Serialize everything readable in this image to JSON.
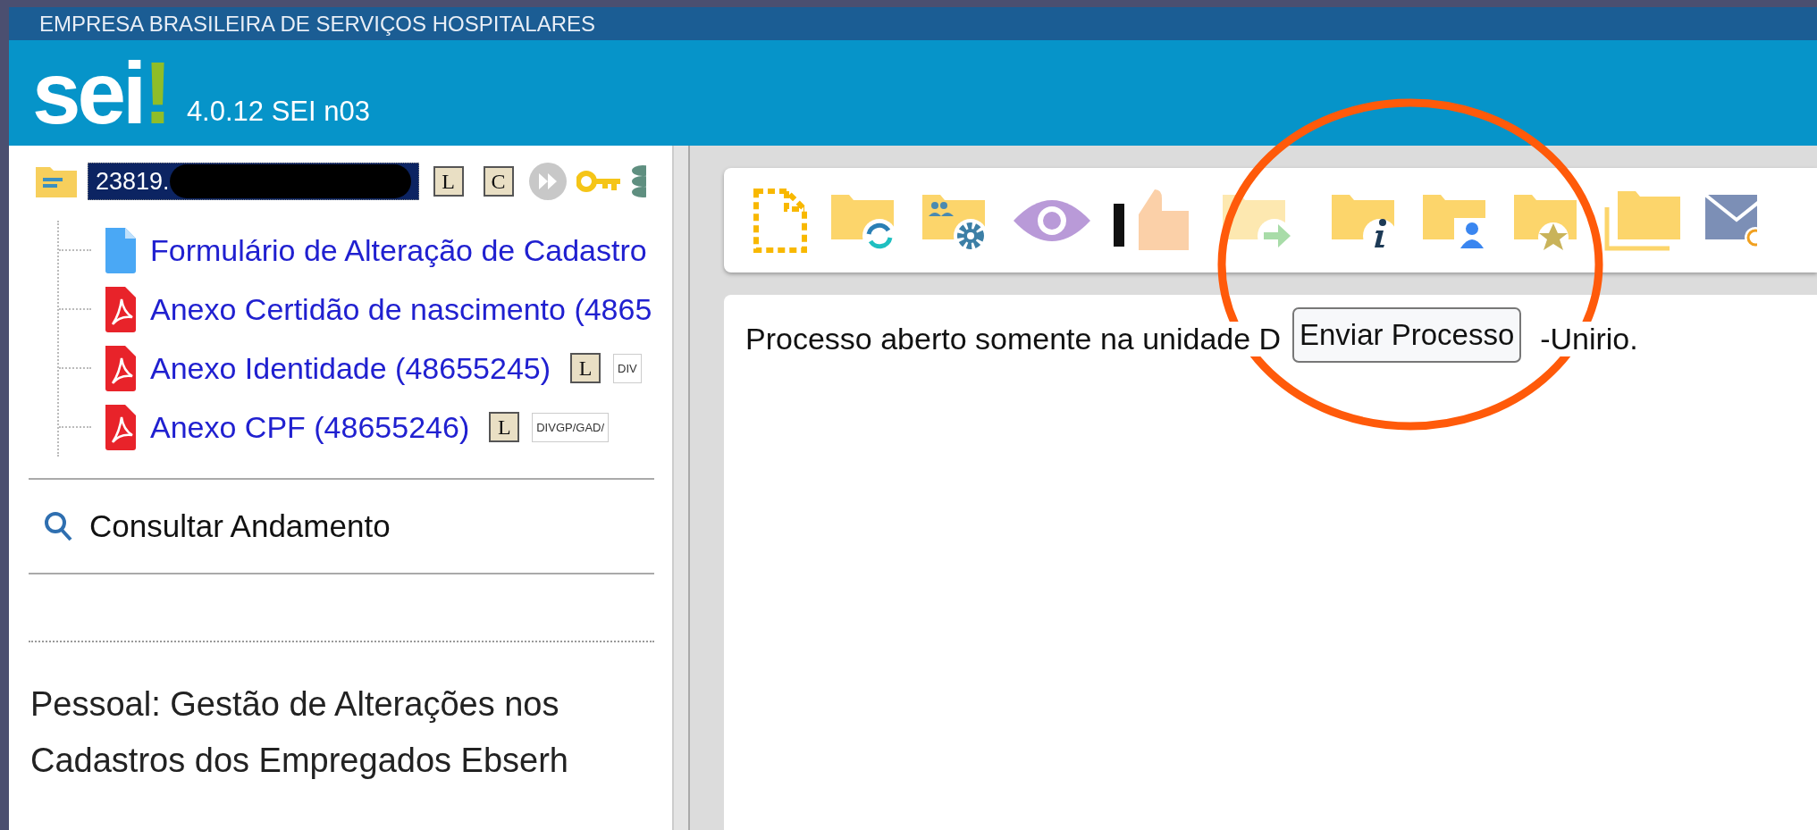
{
  "top_bar": {
    "title": "EMPRESA BRASILEIRA DE SERVIÇOS HOSPITALARES"
  },
  "header": {
    "logo_text": "sei",
    "logo_mark": "!",
    "version": "4.0.12 SEI n03"
  },
  "tree": {
    "root": {
      "label": "23819.",
      "selected": true,
      "badges": [
        "L",
        "C"
      ],
      "children": [
        {
          "kind": "doc",
          "label": "Formulário de Alteração de Cadastro"
        },
        {
          "kind": "pdf",
          "label": "Anexo Certidão de nascimento (4865"
        },
        {
          "kind": "pdf",
          "label": "Anexo Identidade (48655245)",
          "badges": [
            "L"
          ],
          "tag": "DIV"
        },
        {
          "kind": "pdf",
          "label": "Anexo CPF (48655246)",
          "badges": [
            "L"
          ],
          "tag": "DIVGP/GAD/"
        }
      ]
    }
  },
  "consult_link": "Consultar Andamento",
  "process_type": "Pessoal: Gestão de Alterações nos Cadastros dos Empregados Ebserh",
  "message": {
    "start": "Processo aberto somente na unidade D",
    "end": "-Unirio."
  },
  "tooltip": "Enviar Processo"
}
